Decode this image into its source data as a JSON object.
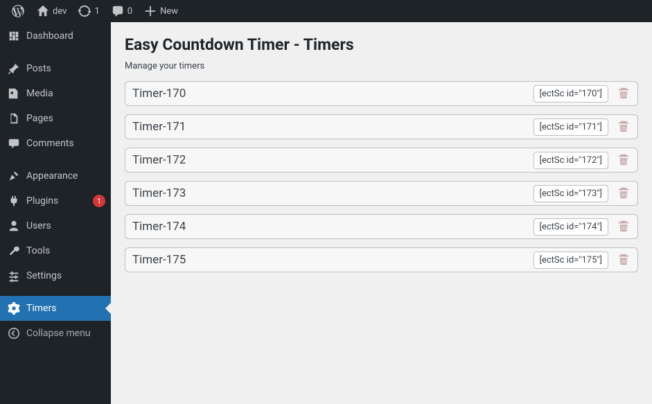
{
  "toolbar": {
    "site_name": "dev",
    "updates_count": "1",
    "comments_count": "0",
    "new_label": "New"
  },
  "sidebar": {
    "items": [
      {
        "id": "dashboard",
        "label": "Dashboard"
      },
      {
        "id": "posts",
        "label": "Posts"
      },
      {
        "id": "media",
        "label": "Media"
      },
      {
        "id": "pages",
        "label": "Pages"
      },
      {
        "id": "comments",
        "label": "Comments"
      },
      {
        "id": "appearance",
        "label": "Appearance"
      },
      {
        "id": "plugins",
        "label": "Plugins",
        "badge": "1"
      },
      {
        "id": "users",
        "label": "Users"
      },
      {
        "id": "tools",
        "label": "Tools"
      },
      {
        "id": "settings",
        "label": "Settings"
      },
      {
        "id": "timers",
        "label": "Timers",
        "current": true
      }
    ],
    "collapse_label": "Collapse menu"
  },
  "page": {
    "title": "Easy Countdown Timer - Timers",
    "subtitle": "Manage your timers"
  },
  "timers": [
    {
      "name": "Timer-170",
      "shortcode": "[ectSc id=\"170\"]"
    },
    {
      "name": "Timer-171",
      "shortcode": "[ectSc id=\"171\"]"
    },
    {
      "name": "Timer-172",
      "shortcode": "[ectSc id=\"172\"]"
    },
    {
      "name": "Timer-173",
      "shortcode": "[ectSc id=\"173\"]"
    },
    {
      "name": "Timer-174",
      "shortcode": "[ectSc id=\"174\"]"
    },
    {
      "name": "Timer-175",
      "shortcode": "[ectSc id=\"175\"]"
    }
  ]
}
